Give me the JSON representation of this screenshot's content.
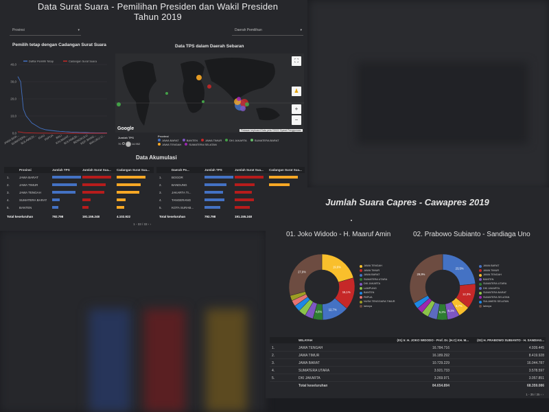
{
  "panel1": {
    "title_line1": "Data Surat Suara - Pemilihan Presiden dan Wakil Presiden",
    "title_line2": "Tahun 2019",
    "dropdown_provinsi": "Provinsi",
    "dropdown_daerah": "Daerah Pemilihan",
    "line_chart_title": "Pemilih tetap dengan Cadangan Surat Suara",
    "map_title": "Data TPS dalam Daerah Sebaran",
    "akumulasi_title": "Data Akumulasi",
    "map_attrib": "Pintasan keyboard  Data peta ©2022  Syarat Penggunaan",
    "google_label": "Google",
    "map_legend": {
      "size_title": "Jumlah TPS",
      "size_min": "70",
      "size_max": "14.952",
      "prov_title": "Provinsi",
      "items": [
        {
          "label": "JAWA BARAT",
          "color": "#4472c4"
        },
        {
          "label": "BANTEN",
          "color": "#7e57c2"
        },
        {
          "label": "JAWA TIMUR",
          "color": "#c62828"
        },
        {
          "label": "DKI JAKARTA",
          "color": "#43a047"
        },
        {
          "label": "SUMATERA BARAT",
          "color": "#66bb6a"
        },
        {
          "label": "JAWA TENGAH",
          "color": "#f9a825"
        },
        {
          "label": "SUMATERA SELATAN",
          "color": "#9c27b0"
        }
      ]
    },
    "table_left": {
      "headers": [
        "Provinsi",
        "Jumlah TPS",
        "Jumlah Surat Sua...",
        "Cadangan Surat Sua..."
      ],
      "rows": [
        {
          "n": "1.",
          "name": "JAWA BARAT",
          "v": [
            1.0,
            1.0,
            1.0
          ]
        },
        {
          "n": "2.",
          "name": "JAWA TIMUR",
          "v": [
            0.85,
            0.82,
            0.84
          ]
        },
        {
          "n": "3.",
          "name": "JAWA TENGAH",
          "v": [
            0.8,
            0.75,
            0.78
          ]
        },
        {
          "n": "4.",
          "name": "SUMATERA BARAT",
          "v": [
            0.27,
            0.28,
            0.3
          ]
        },
        {
          "n": "5.",
          "name": "BANTEN",
          "v": [
            0.22,
            0.22,
            0.25
          ]
        }
      ],
      "total_label": "Total keseluruhan",
      "totals": [
        "792.798",
        "191.155.248",
        "4.102.922"
      ],
      "pager": "1 - 33 / 33"
    },
    "table_right": {
      "headers": [
        "Daerah Pe...",
        "Jumlah TPS",
        "Jumlah Surat Sua...",
        "Cadangan Surat Sua..."
      ],
      "rows": [
        {
          "n": "1.",
          "name": "BOGOR",
          "v": [
            1.0,
            1.0,
            1.0
          ]
        },
        {
          "n": "2.",
          "name": "BANDUNG",
          "v": [
            0.75,
            0.7,
            0.72
          ]
        },
        {
          "n": "3.",
          "name": "JAKARTA TI...",
          "v": [
            0.65,
            0.6,
            0.63
          ]
        },
        {
          "n": "4.",
          "name": "TANGERANG",
          "v": [
            0.7,
            0.67,
            0.7
          ]
        },
        {
          "n": "5.",
          "name": "KOTA SURAB...",
          "v": [
            0.55,
            0.52,
            0.55
          ]
        }
      ],
      "total_label": "Total keseluruhan",
      "totals": [
        "792.798",
        "191.155.248",
        "4.102.922"
      ],
      "pager": "1 - 100 / 495"
    },
    "bar_colors": [
      "#4472c4",
      "#b71c1c",
      "#f9a825"
    ]
  },
  "chart_data": {
    "type": "line",
    "title": "Pemilih tetap dengan Cadangan Surat Suara",
    "ylim": [
      0,
      40
    ],
    "yticks": [
      "40,0",
      "30,0",
      "20,0",
      "10,0",
      "0,0"
    ],
    "categories": [
      "JAWA BAR...",
      "SUMATERA...",
      "SULAWESI...",
      "RIAU",
      "PAPUA",
      "BALI",
      "KALIMANT...",
      "SULAWESI...",
      "BENGKULU",
      "KEP. BANG...",
      "MALUKU U..."
    ],
    "series": [
      {
        "name": "Daftar Pemilih Tetap",
        "color": "#4472c4",
        "values": [
          33,
          30,
          14,
          10,
          8,
          6,
          5,
          4,
          3,
          2.5,
          2,
          1.8,
          1.6,
          1.4,
          1.2,
          1.1,
          1,
          0.9,
          0.8,
          0.7,
          0.6,
          0.55,
          0.5,
          0.45,
          0.4,
          0.35,
          0.3,
          0.28,
          0.25,
          0.22,
          0.2,
          0.18,
          0.15
        ]
      },
      {
        "name": "Cadangan Surat Suara",
        "color": "#c62828",
        "values": [
          0.8,
          0.7,
          0.35,
          0.25,
          0.2,
          0.15,
          0.12,
          0.1,
          0.08,
          0.07,
          0.06,
          0.05,
          0.05,
          0.04,
          0.04,
          0.03,
          0.03,
          0.03,
          0.02,
          0.02,
          0.02,
          0.02,
          0.01,
          0.01,
          0.01,
          0.01,
          0.01,
          0.01,
          0.01,
          0.01,
          0.01,
          0.01,
          0.01
        ]
      }
    ]
  },
  "panel2": {
    "title": "Jumlah Suara Capres - Cawapres 2019",
    "pie1_title": "01. Joko Widodo - H. Maaruf Amin",
    "pie2_title": "02. Prabowo Subianto - Sandiaga Uno",
    "pie1": {
      "slices": [
        {
          "label": "JAWA TENGAH",
          "value": 19.6,
          "color": "#f9bf2c",
          "text": "19,6%"
        },
        {
          "label": "JAWA TIMUR",
          "value": 15.1,
          "color": "#c62828",
          "text": "15,1%"
        },
        {
          "label": "JAWA BARAT",
          "value": 12.7,
          "color": "#4472c4",
          "text": "12,7%"
        },
        {
          "label": "SUMATERA UTARA",
          "value": 4.6,
          "color": "#2e7d32",
          "text": "4,6%"
        },
        {
          "label": "DKI JAKARTA",
          "value": 3.9,
          "color": "#7e57c2",
          "text": ""
        },
        {
          "label": "LAMPUNG",
          "value": 3.5,
          "color": "#8bc34a",
          "text": ""
        },
        {
          "label": "BANTEN",
          "value": 3.0,
          "color": "#1e88e5",
          "text": ""
        },
        {
          "label": "PAPUA",
          "value": 2.8,
          "color": "#e57373",
          "text": ""
        },
        {
          "label": "NUSA TENGGARA TIMUR",
          "value": 2.5,
          "color": "#9e9e24",
          "text": ""
        },
        {
          "label": "lainnya",
          "value": 27.9,
          "color": "#6d4c41",
          "text": "27,9%"
        }
      ]
    },
    "pie2": {
      "slices": [
        {
          "label": "JAWA BARAT",
          "value": 23.5,
          "color": "#4472c4",
          "text": "23,5%"
        },
        {
          "label": "JAWA TIMUR",
          "value": 12.3,
          "color": "#c62828",
          "text": "12,3%"
        },
        {
          "label": "JAWA TENGAH",
          "value": 5.7,
          "color": "#f9bf2c",
          "text": "5,7%"
        },
        {
          "label": "BANTEN",
          "value": 6.1,
          "color": "#7e57c2",
          "text": "6,1%"
        },
        {
          "label": "SUMATERA UTARA",
          "value": 5.2,
          "color": "#2e7d32",
          "text": "5,2%"
        },
        {
          "label": "DKI JAKARTA",
          "value": 4.5,
          "color": "#5c6bc0",
          "text": ""
        },
        {
          "label": "SUMATERA BARAT",
          "value": 3.5,
          "color": "#8bc34a",
          "text": ""
        },
        {
          "label": "SUMATERA SELATAN",
          "value": 3.0,
          "color": "#9c27b0",
          "text": ""
        },
        {
          "label": "SULAWESI SELATAN",
          "value": 3.0,
          "color": "#1e88e5",
          "text": ""
        },
        {
          "label": "lainnya",
          "value": 33.2,
          "color": "#6d4c41",
          "text": "29,9%"
        }
      ]
    },
    "table": {
      "headers": [
        "WILAYAH",
        "(01) Ir. H. JOKO WIDODO - Prof. Dr. (H.C) KH. M...",
        "(02) H. PRABOWO SUBIANTO - H. SANDIAG..."
      ],
      "rows": [
        {
          "n": "1.",
          "name": "JAWA TENGAH",
          "a": "16.784.716",
          "b": "4.939.445"
        },
        {
          "n": "2.",
          "name": "JAWA TIMUR",
          "a": "16.189.292",
          "b": "8.419.928"
        },
        {
          "n": "3.",
          "name": "JAWA BARAT",
          "a": "10.729.229",
          "b": "16.044.787"
        },
        {
          "n": "4.",
          "name": "SUMATERA UTARA",
          "a": "3.921.733",
          "b": "3.578.597"
        },
        {
          "n": "5.",
          "name": "DKI JAKARTA",
          "a": "3.269.971",
          "b": "3.057.851"
        }
      ],
      "total_label": "Total keseluruhan",
      "totals": [
        "84.654.894",
        "68.359.086"
      ],
      "pager": "1 - 35 / 35"
    }
  }
}
